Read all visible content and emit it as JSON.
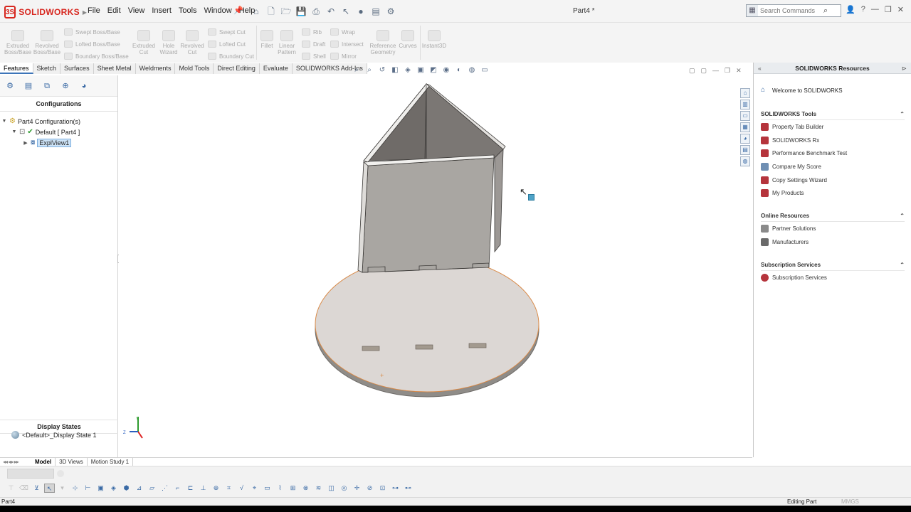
{
  "app": {
    "brand": "SOLIDWORKS",
    "logo_mark": "3S",
    "document_title": "Part4 *"
  },
  "menu": [
    "File",
    "Edit",
    "View",
    "Insert",
    "Tools",
    "Window",
    "Help"
  ],
  "search": {
    "placeholder": "Search Commands"
  },
  "command_manager": {
    "extruded_boss": "Extruded\nBoss/Base",
    "revolved_boss": "Revolved\nBoss/Base",
    "swept_boss": "Swept Boss/Base",
    "lofted_boss": "Lofted Boss/Base",
    "boundary_boss": "Boundary Boss/Base",
    "extruded_cut": "Extruded\nCut",
    "hole_wizard": "Hole\nWizard",
    "revolved_cut": "Revolved\nCut",
    "swept_cut": "Swept Cut",
    "lofted_cut": "Lofted Cut",
    "boundary_cut": "Boundary Cut",
    "fillet": "Fillet",
    "linear_pattern": "Linear\nPattern",
    "rib": "Rib",
    "draft": "Draft",
    "shell": "Shell",
    "wrap": "Wrap",
    "intersect": "Intersect",
    "mirror": "Mirror",
    "reference_geometry": "Reference\nGeometry",
    "curves": "Curves",
    "instant3d": "Instant3D"
  },
  "tabs": [
    "Features",
    "Sketch",
    "Surfaces",
    "Sheet Metal",
    "Weldments",
    "Mold Tools",
    "Direct Editing",
    "Evaluate",
    "SOLIDWORKS Add-Ins"
  ],
  "left_panel": {
    "title": "Configurations",
    "tree": {
      "root": "Part4 Configuration(s)",
      "config": "Default [ Part4 ]",
      "view": "ExplView1"
    },
    "display_states_title": "Display States",
    "display_state_item": "<Default>_Display State 1"
  },
  "right_panel": {
    "title": "SOLIDWORKS Resources",
    "welcome": "Welcome to SOLIDWORKS",
    "sections": [
      {
        "title": "SOLIDWORKS Tools",
        "items": [
          "Property Tab Builder",
          "SOLIDWORKS Rx",
          "Performance Benchmark Test",
          "Compare My Score",
          "Copy Settings Wizard",
          "My Products"
        ]
      },
      {
        "title": "Online Resources",
        "items": [
          "Partner Solutions",
          "Manufacturers"
        ]
      },
      {
        "title": "Subscription Services",
        "items": [
          "Subscription Services"
        ]
      }
    ]
  },
  "bottom_tabs": [
    "Model",
    "3D Views",
    "Motion Study 1"
  ],
  "status": {
    "left": "Part4",
    "middle": "Editing Part",
    "units": "MMGS"
  },
  "triad": {
    "y": "Y",
    "z": "Z"
  },
  "colors": {
    "brand_red": "#d7261e",
    "accent_blue": "#3c74b8",
    "model_gray": "#a9a6a2",
    "edge_orange": "#d98b4a"
  }
}
